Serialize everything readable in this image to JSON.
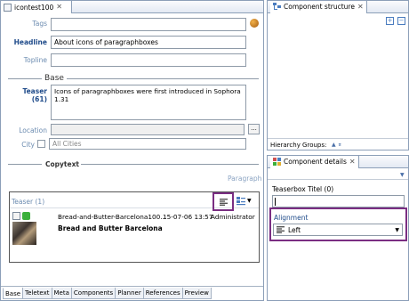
{
  "editor": {
    "tab_title": "icontest100",
    "fields": {
      "tags_label": "Tags",
      "headline_label": "Headline",
      "headline_value": "About icons of paragraphboxes",
      "topline_label": "Topline"
    },
    "base_section": "Base",
    "teaser_label": "Teaser",
    "teaser_count": "(61)",
    "teaser_text": "Icons of paragraphboxes were first introduced in Sophora 1.31",
    "location_label": "Location",
    "location_button": "...",
    "city_label": "City",
    "city_placeholder": "All Cities",
    "copytext_label": "Copytext",
    "paragraph_label": "Paragraph",
    "teaserbox": {
      "title": "Teaser (1)",
      "item": {
        "filename": "Bread-and-Butter-Barcelona100...",
        "date": "15-07-06 13:57",
        "user": "Administrator",
        "title": "Bread and Butter Barcelona"
      }
    },
    "bottom_tabs": [
      "Base",
      "Teletext",
      "Meta",
      "Components",
      "Planner",
      "References",
      "Preview"
    ]
  },
  "component_structure": {
    "title": "Component structure",
    "hierarchy_label": "Hierarchy Groups:"
  },
  "component_details": {
    "title": "Component details",
    "teaserbox_title_label": "Teaserbox Titel (0)",
    "alignment_label": "Alignment",
    "alignment_value": "Left"
  },
  "colors": {
    "accent_purple": "#7a2e82",
    "label_blue": "#1f4b8a",
    "frame_border": "#8c9fb8"
  }
}
